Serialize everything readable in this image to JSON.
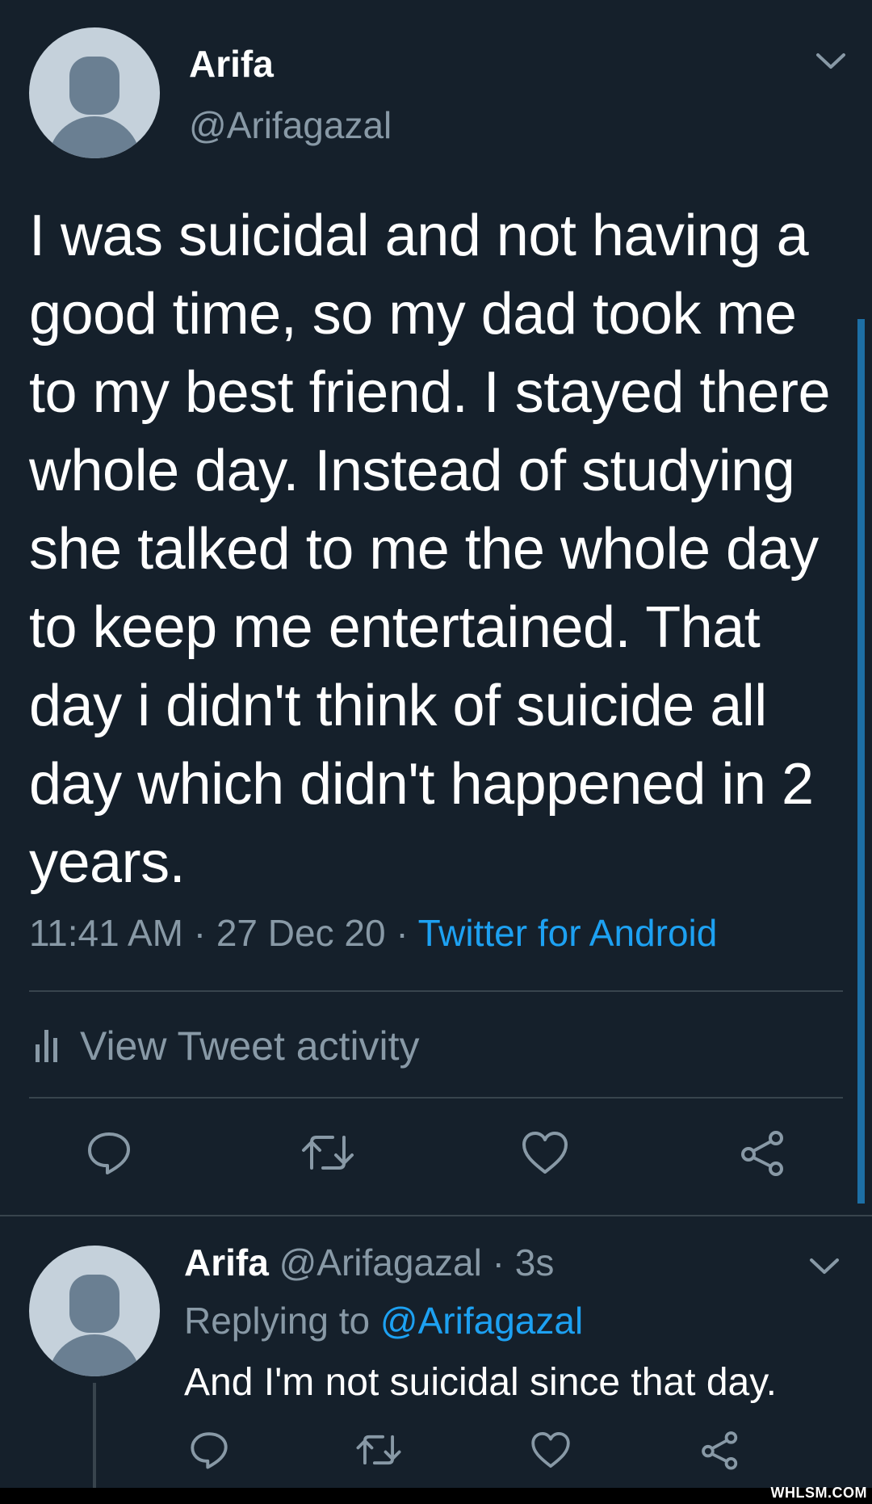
{
  "tweet": {
    "author_name": "Arifa",
    "author_handle": "@Arifagazal",
    "text": "I was suicidal and not having a good time, so my dad took me to my best friend. I stayed there whole day. Instead of studying she talked to me the whole day to keep me entertained. That day i didn't think of suicide all day which didn't happened in 2  years.",
    "time": "11:41 AM",
    "date": "27 Dec 20",
    "source": "Twitter for Android",
    "separator": " · ",
    "activity_label": "View Tweet activity"
  },
  "reply": {
    "author_name": "Arifa",
    "author_handle": "@Arifagazal",
    "separator": " · ",
    "age": "3s",
    "replying_prefix": "Replying to ",
    "replying_to": "@Arifagazal",
    "text": "And I'm not suicidal since that day."
  },
  "watermark": "WHLSM.COM",
  "icons": [
    "chevron-down-icon",
    "bar-chart-icon",
    "reply-icon",
    "retweet-icon",
    "like-icon",
    "share-icon"
  ],
  "colors": {
    "background": "#15202b",
    "text": "#ffffff",
    "secondary": "#8899a6",
    "accent": "#1da1f2",
    "divider": "#38444d"
  }
}
